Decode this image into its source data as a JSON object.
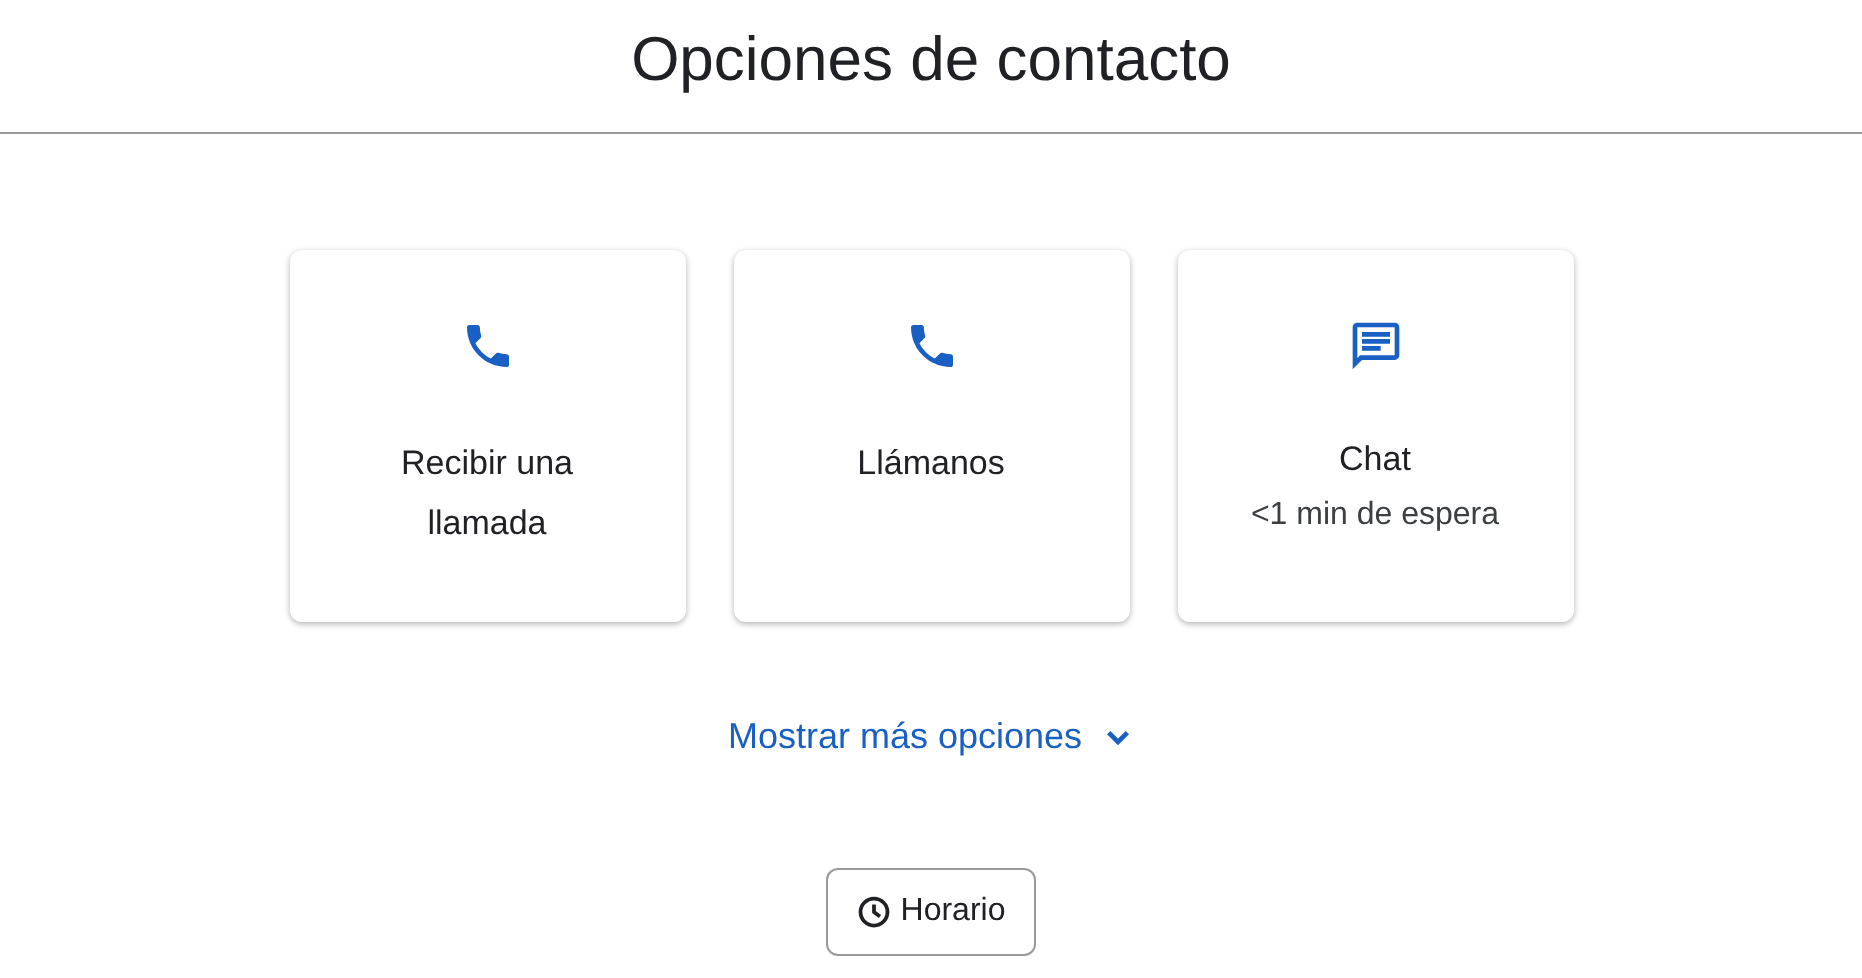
{
  "title": "Opciones de contacto",
  "options": [
    {
      "kind": "phone",
      "label": "Recibir una llamada"
    },
    {
      "kind": "phone",
      "label": "Llámanos"
    },
    {
      "kind": "chat",
      "label": "Chat",
      "subtitle": "<1 min de espera"
    }
  ],
  "more_link": "Mostrar más opciones",
  "hours_button": "Horario"
}
